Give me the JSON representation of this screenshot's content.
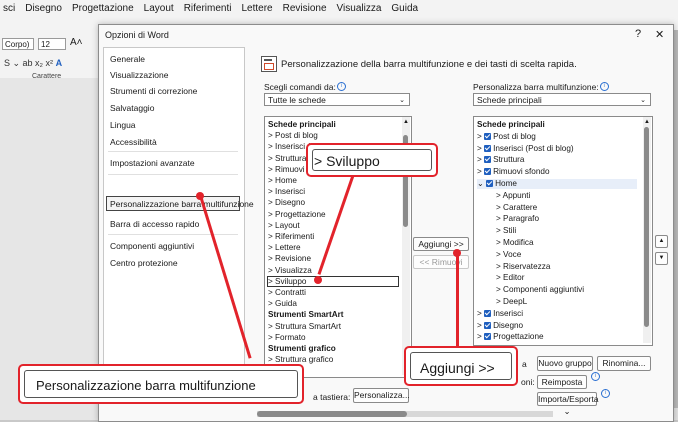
{
  "word": {
    "menu": [
      "sci",
      "Disegno",
      "Progettazione",
      "Layout",
      "Riferimenti",
      "Lettere",
      "Revisione",
      "Visualizza",
      "Guida"
    ],
    "font_name": "Corpo)",
    "font_size": "12",
    "group_label": "Carattere"
  },
  "dialog": {
    "title": "Opzioni di Word",
    "help": "?",
    "close": "✕",
    "nav": [
      "Generale",
      "Visualizzazione",
      "Strumenti di correzione",
      "Salvataggio",
      "Lingua",
      "Accessibilità",
      "Impostazioni avanzate",
      "Personalizzazione barra multifunzione",
      "Barra di accesso rapido",
      "Componenti aggiuntivi",
      "Centro protezione"
    ],
    "heading": "Personalizzazione della barra multifunzione e dei tasti di scelta rapida.",
    "choose_label": "Scegli comandi da:",
    "choose_value": "Tutte le schede",
    "customize_label": "Personalizza barra multifunzione:",
    "customize_value": "Schede principali",
    "left_list": [
      {
        "t": "Schede principali",
        "b": true
      },
      {
        "t": "> Post di blog"
      },
      {
        "t": "> Inserisci (Post di blog)"
      },
      {
        "t": "> Struttura"
      },
      {
        "t": "> Rimuovi sfondo"
      },
      {
        "t": "> Home"
      },
      {
        "t": "> Inserisci"
      },
      {
        "t": "> Disegno"
      },
      {
        "t": "> Progettazione"
      },
      {
        "t": "> Layout"
      },
      {
        "t": "> Riferimenti"
      },
      {
        "t": "> Lettere"
      },
      {
        "t": "> Revisione"
      },
      {
        "t": "> Visualizza"
      },
      {
        "t": "> Sviluppo"
      },
      {
        "t": "> Contratti"
      },
      {
        "t": "> Guida"
      },
      {
        "t": "Strumenti SmartArt",
        "b": true
      },
      {
        "t": "> Struttura SmartArt"
      },
      {
        "t": "> Formato"
      },
      {
        "t": "Strumenti grafico",
        "b": true
      },
      {
        "t": "> Struttura grafico"
      }
    ],
    "right_list": [
      {
        "t": "Schede principali",
        "b": true,
        "cb": false
      },
      {
        "t": "Post di blog",
        "cb": true,
        "arrow": ">"
      },
      {
        "t": "Inserisci (Post di blog)",
        "cb": true,
        "arrow": ">"
      },
      {
        "t": "Struttura",
        "cb": true,
        "arrow": ">"
      },
      {
        "t": "Rimuovi sfondo",
        "cb": true,
        "arrow": ">"
      },
      {
        "t": "Home",
        "cb": true,
        "arrow": "v"
      },
      {
        "t": "> Appunti",
        "indent": true
      },
      {
        "t": "> Carattere",
        "indent": true
      },
      {
        "t": "> Paragrafo",
        "indent": true
      },
      {
        "t": "> Stili",
        "indent": true
      },
      {
        "t": "> Modifica",
        "indent": true
      },
      {
        "t": "> Voce",
        "indent": true
      },
      {
        "t": "> Riservatezza",
        "indent": true
      },
      {
        "t": "> Editor",
        "indent": true
      },
      {
        "t": "> Componenti aggiuntivi",
        "indent": true
      },
      {
        "t": "> DeepL",
        "indent": true
      },
      {
        "t": "Inserisci",
        "cb": true,
        "arrow": ">"
      },
      {
        "t": "Disegno",
        "cb": true,
        "arrow": ">"
      },
      {
        "t": "Progettazione",
        "cb": true,
        "arrow": ">"
      }
    ],
    "add_button": "Aggiungi >>",
    "remove_button": "<< Rimuovi",
    "new_tab_partial": "a",
    "new_group": "Nuovo gruppo",
    "rename": "Rinomina...",
    "reset": "Reimposta",
    "import_export": "Importa/Esporta",
    "keyboard_partial": "a tastiera:",
    "keyboard_btn": "Personalizza...",
    "customize_partial": "oni:"
  },
  "callouts": {
    "sviluppo": "> Sviluppo",
    "aggiungi": "Aggiungi >>",
    "personalizzazione": "Personalizzazione barra multifunzione"
  },
  "colors": {
    "accent_red": "#e2232b",
    "checkbox_blue": "#1f5fbf",
    "arrow_blue": "#1a5fb4"
  }
}
